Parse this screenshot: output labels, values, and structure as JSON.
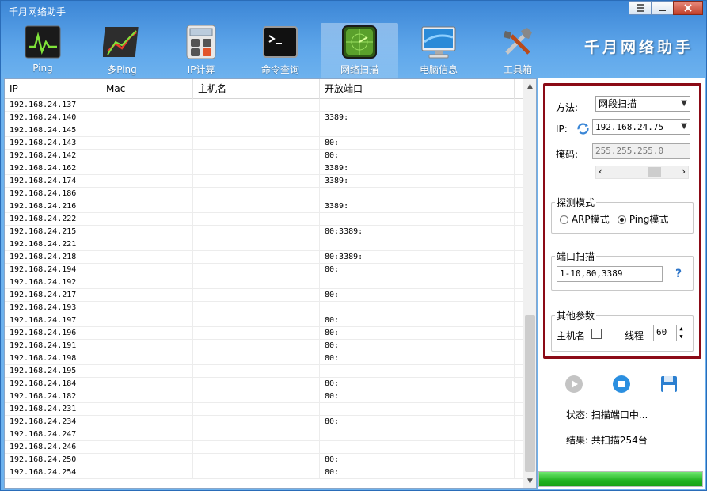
{
  "app": {
    "title": "千月网络助手",
    "brand": "千月网络助手"
  },
  "window_buttons": [
    "menu-icon",
    "minimize-icon",
    "close-icon"
  ],
  "toolbar": [
    {
      "label": "Ping",
      "icon": "ping-monitor-icon"
    },
    {
      "label": "多Ping",
      "icon": "multi-ping-chart-icon"
    },
    {
      "label": "IP计算",
      "icon": "calculator-icon"
    },
    {
      "label": "命令查询",
      "icon": "terminal-icon"
    },
    {
      "label": "网络扫描",
      "icon": "radar-scan-icon",
      "active": true
    },
    {
      "label": "电脑信息",
      "icon": "computer-monitor-icon"
    },
    {
      "label": "工具箱",
      "icon": "tools-icon"
    }
  ],
  "table": {
    "columns": [
      "IP",
      "Mac",
      "主机名",
      "开放端口"
    ],
    "rows": [
      [
        "192.168.24.137",
        "",
        "",
        ""
      ],
      [
        "192.168.24.140",
        "",
        "",
        "3389:"
      ],
      [
        "192.168.24.145",
        "",
        "",
        ""
      ],
      [
        "192.168.24.143",
        "",
        "",
        "80:"
      ],
      [
        "192.168.24.142",
        "",
        "",
        "80:"
      ],
      [
        "192.168.24.162",
        "",
        "",
        "3389:"
      ],
      [
        "192.168.24.174",
        "",
        "",
        "3389:"
      ],
      [
        "192.168.24.186",
        "",
        "",
        ""
      ],
      [
        "192.168.24.216",
        "",
        "",
        "3389:"
      ],
      [
        "192.168.24.222",
        "",
        "",
        ""
      ],
      [
        "192.168.24.215",
        "",
        "",
        "80:3389:"
      ],
      [
        "192.168.24.221",
        "",
        "",
        ""
      ],
      [
        "192.168.24.218",
        "",
        "",
        "80:3389:"
      ],
      [
        "192.168.24.194",
        "",
        "",
        "80:"
      ],
      [
        "192.168.24.192",
        "",
        "",
        ""
      ],
      [
        "192.168.24.217",
        "",
        "",
        "80:"
      ],
      [
        "192.168.24.193",
        "",
        "",
        ""
      ],
      [
        "192.168.24.197",
        "",
        "",
        "80:"
      ],
      [
        "192.168.24.196",
        "",
        "",
        "80:"
      ],
      [
        "192.168.24.191",
        "",
        "",
        "80:"
      ],
      [
        "192.168.24.198",
        "",
        "",
        "80:"
      ],
      [
        "192.168.24.195",
        "",
        "",
        ""
      ],
      [
        "192.168.24.184",
        "",
        "",
        "80:"
      ],
      [
        "192.168.24.182",
        "",
        "",
        "80:"
      ],
      [
        "192.168.24.231",
        "",
        "",
        ""
      ],
      [
        "192.168.24.234",
        "",
        "",
        "80:"
      ],
      [
        "192.168.24.247",
        "",
        "",
        ""
      ],
      [
        "192.168.24.246",
        "",
        "",
        ""
      ],
      [
        "192.168.24.250",
        "",
        "",
        "80:"
      ],
      [
        "192.168.24.254",
        "",
        "",
        "80:"
      ]
    ]
  },
  "settings": {
    "method_label": "方法:",
    "method_value": "网段扫描",
    "ip_label": "IP:",
    "ip_value": "192.168.24.75",
    "mask_label": "掩码:",
    "mask_value": "255.255.255.0",
    "detect_legend": "探测模式",
    "arp_label": "ARP模式",
    "ping_label": "Ping模式",
    "detect_mode": "ping",
    "port_legend": "端口扫描",
    "port_value": "1-10,80,3389",
    "help_glyph": "?",
    "other_legend": "其他参数",
    "hostname_label": "主机名",
    "hostname_checked": false,
    "thread_label": "线程",
    "thread_value": "60"
  },
  "status": {
    "status_text": "状态: 扫描端口中...",
    "result_text": "结果: 共扫描254台",
    "progress": 1.0
  },
  "colors": {
    "accent": "#3c86d6",
    "highlight_border": "#8b0a16",
    "progress": "#22b322"
  }
}
